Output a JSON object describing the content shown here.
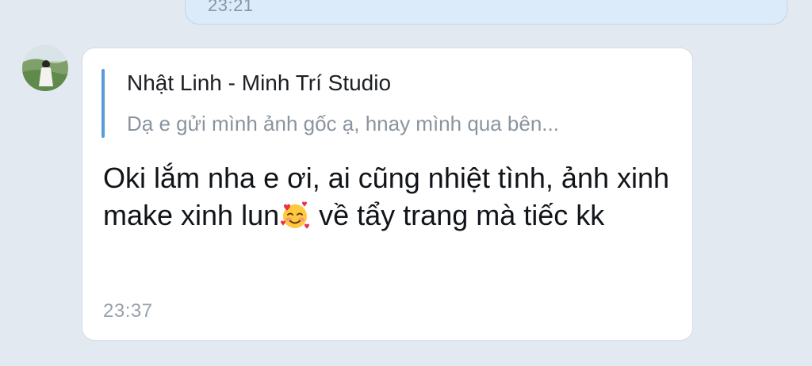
{
  "previous_message": {
    "time": "23:21"
  },
  "contact": {
    "avatar_label": "contact-avatar"
  },
  "message": {
    "quote": {
      "sender": "Nhật Linh - Minh Trí Studio",
      "text": "Dạ e gửi mình ảnh gốc ạ, hnay mình qua bên..."
    },
    "text_part1": "Oki lắm nha e ơi, ai cũng nhiệt tình, ảnh xinh make xinh lun",
    "emoji": "smiling-face-with-hearts",
    "text_part2": " về tẩy trang mà tiếc kk",
    "time": "23:37"
  },
  "colors": {
    "background": "#e2e9f1",
    "own_bubble": "#dbebfa",
    "bubble": "#ffffff",
    "quote_bar": "#5b9bd9"
  }
}
